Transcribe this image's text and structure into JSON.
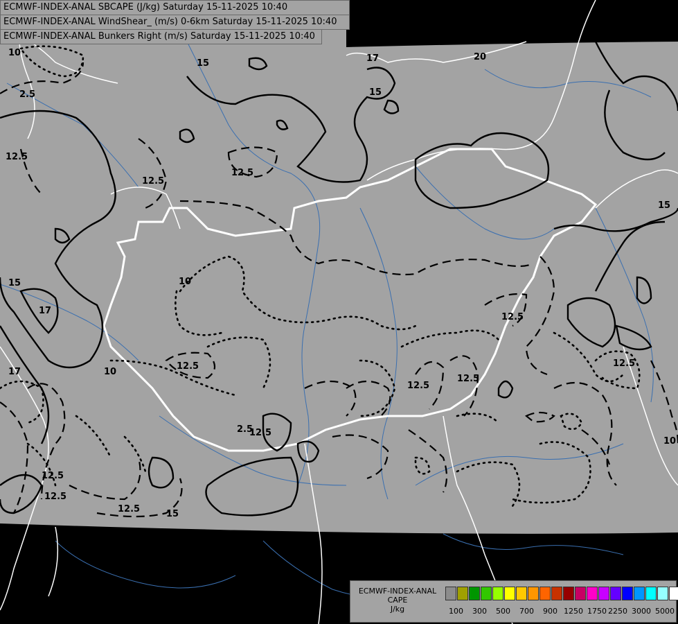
{
  "header": {
    "line1": "ECMWF-INDEX-ANAL SBCAPE (J/kg) Saturday 15-11-2025 10:40",
    "line2": "ECMWF-INDEX-ANAL WindShear_ (m/s) 0-6km Saturday 15-11-2025 10:40",
    "line3": "ECMWF-INDEX-ANAL Bunkers Right (m/s) Saturday 15-11-2025 10:40"
  },
  "contour_labels": [
    "17",
    "20",
    "15",
    "10",
    "12.5",
    "2.5",
    "12.5",
    "15",
    "12.5",
    "12.5",
    "15",
    "17",
    "10",
    "12.5",
    "12.5",
    "12.5",
    "12.5",
    "2.5",
    "12.5",
    "15",
    "10",
    "12.5",
    "10",
    "15",
    "17",
    "12.5",
    "12.5"
  ],
  "legend": {
    "title_lines": [
      "ECMWF-INDEX-ANAL",
      "CAPE",
      "J/kg"
    ],
    "colors": [
      "#8c8c8c",
      "#a0a000",
      "#009600",
      "#32c800",
      "#96ff00",
      "#ffff00",
      "#ffc800",
      "#ff9600",
      "#ff6400",
      "#c83200",
      "#960000",
      "#c80064",
      "#ff00c8",
      "#c800ff",
      "#6400ff",
      "#0000ff",
      "#0096ff",
      "#00ffff",
      "#96ffff",
      "#ffffff"
    ],
    "ticks": [
      "100",
      "300",
      "500",
      "700",
      "900",
      "1250",
      "1750",
      "2250",
      "3000",
      "5000"
    ]
  }
}
